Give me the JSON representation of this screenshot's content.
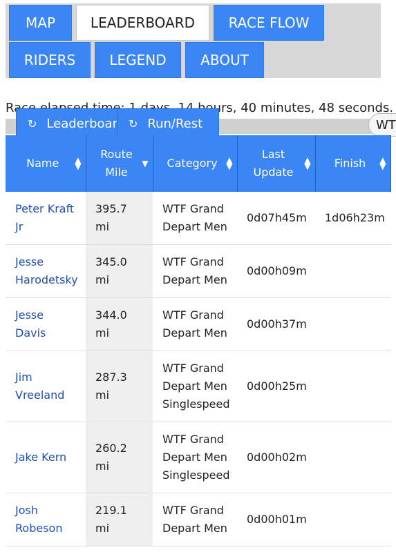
{
  "tabs": [
    {
      "label": "MAP",
      "active": false
    },
    {
      "label": "LEADERBOARD",
      "active": true
    },
    {
      "label": "RACE FLOW",
      "active": false
    },
    {
      "label": "RIDERS",
      "active": false
    },
    {
      "label": "LEGEND",
      "active": false
    },
    {
      "label": "ABOUT",
      "active": false
    }
  ],
  "elapsed_text": "Race elapsed time: 1 days, 14 hours, 40 minutes, 48 seconds.",
  "toolbar": {
    "leaderboard_label": "Leaderboard",
    "runrest_label": "Run/Rest",
    "wt_label": "WT"
  },
  "columns": [
    "Name",
    "Route Mile",
    "Category",
    "Last Update",
    "Finish"
  ],
  "rows": [
    {
      "name": "Peter Kraft Jr",
      "mile": "395.7 mi",
      "category": "WTF Grand Depart Men",
      "update": "0d07h45m",
      "finish": "1d06h23m"
    },
    {
      "name": "Jesse Harodetsky",
      "mile": "345.0 mi",
      "category": "WTF Grand Depart Men",
      "update": "0d00h09m",
      "finish": ""
    },
    {
      "name": "Jesse Davis",
      "mile": "344.0 mi",
      "category": "WTF Grand Depart Men",
      "update": "0d00h37m",
      "finish": ""
    },
    {
      "name": "Jim Vreeland",
      "mile": "287.3 mi",
      "category": "WTF Grand Depart Men Singlespeed",
      "update": "0d00h25m",
      "finish": ""
    },
    {
      "name": "Jake Kern",
      "mile": "260.2 mi",
      "category": "WTF Grand Depart Men Singlespeed",
      "update": "0d00h02m",
      "finish": ""
    },
    {
      "name": "Josh Robeson",
      "mile": "219.1 mi",
      "category": "WTF Grand Depart Men",
      "update": "0d00h01m",
      "finish": ""
    }
  ],
  "colors": {
    "accent": "#3a86f5",
    "link": "#1f4fb0"
  },
  "icons": {
    "refresh": "refresh-icon",
    "sort": "sort-icon",
    "sort_desc": "sort-desc-icon"
  }
}
